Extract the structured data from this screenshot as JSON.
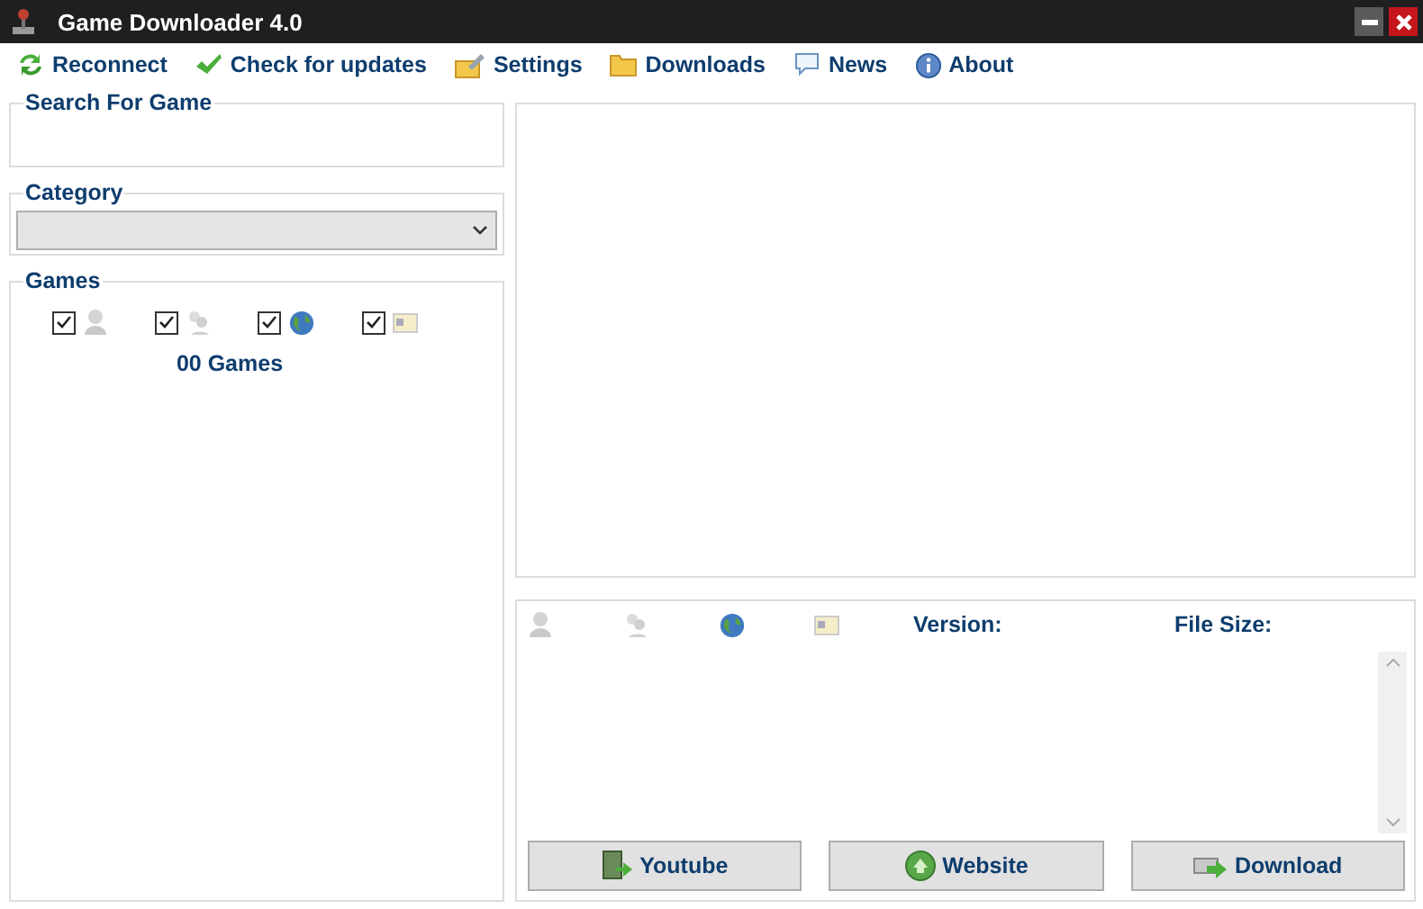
{
  "window": {
    "title": "Game Downloader 4.0"
  },
  "menu": [
    {
      "label": "Reconnect",
      "kind": "reconnect"
    },
    {
      "label": "Check for updates",
      "kind": "check"
    },
    {
      "label": "Settings",
      "kind": "settings"
    },
    {
      "label": "Downloads",
      "kind": "folder"
    },
    {
      "label": "News",
      "kind": "news"
    },
    {
      "label": "About",
      "kind": "about"
    }
  ],
  "search": {
    "label": "Search For Game"
  },
  "category": {
    "label": "Category"
  },
  "games": {
    "label": "Games",
    "filters": [
      {
        "kind": "single",
        "checked": true
      },
      {
        "kind": "multi",
        "checked": true
      },
      {
        "kind": "online",
        "checked": true
      },
      {
        "kind": "card",
        "checked": true
      }
    ],
    "count": "00 Games"
  },
  "details": {
    "version_label": "Version:",
    "file_size_label": "File Size:"
  },
  "buttons": [
    {
      "label": "Youtube",
      "kind": "youtube"
    },
    {
      "label": "Website",
      "kind": "website"
    },
    {
      "label": "Download",
      "kind": "download"
    }
  ]
}
